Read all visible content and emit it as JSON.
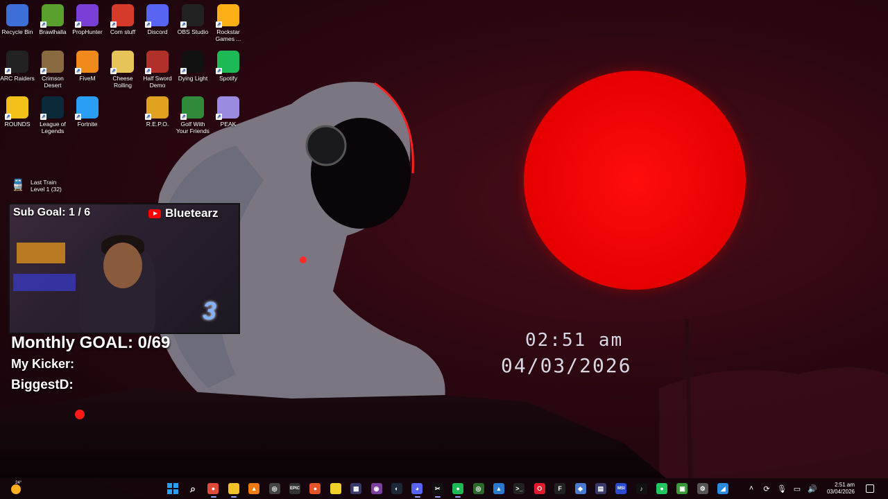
{
  "desktop_icons": [
    {
      "label": "Recycle Bin",
      "icon": "recycle-bin-icon",
      "color": "#3d6fd6"
    },
    {
      "label": "Brawlhalla",
      "icon": "brawlhalla-icon",
      "color": "#5aa02c"
    },
    {
      "label": "PropHunter",
      "icon": "prophunter-icon",
      "color": "#7a3fd6"
    },
    {
      "label": "Com stuff",
      "icon": "power-icon",
      "color": "#d63a2a"
    },
    {
      "label": "Discord",
      "icon": "discord-icon",
      "color": "#5865f2"
    },
    {
      "label": "OBS Studio",
      "icon": "obs-icon",
      "color": "#222222"
    },
    {
      "label": "Rockstar Games ...",
      "icon": "rockstar-icon",
      "color": "#fcaf17"
    },
    {
      "label": "ARC Raiders",
      "icon": "arc-raiders-icon",
      "color": "#222222"
    },
    {
      "label": "Crimson Desert",
      "icon": "crimson-desert-icon",
      "color": "#8a6a40"
    },
    {
      "label": "FiveM",
      "icon": "fivem-icon",
      "color": "#f08a1a"
    },
    {
      "label": "Cheese Rolling",
      "icon": "cheese-icon",
      "color": "#e6c45a"
    },
    {
      "label": "Half Sword Demo",
      "icon": "half-sword-icon",
      "color": "#b0302a"
    },
    {
      "label": "Dying Light",
      "icon": "dying-light-icon",
      "color": "#111111"
    },
    {
      "label": "Spotify",
      "icon": "spotify-icon",
      "color": "#1db954"
    },
    {
      "label": "ROUNDS",
      "icon": "rounds-icon",
      "color": "#f2c21b"
    },
    {
      "label": "League of Legends",
      "icon": "league-icon",
      "color": "#0a2a3a"
    },
    {
      "label": "Fortnite",
      "icon": "fortnite-icon",
      "color": "#2a9df4"
    },
    {
      "label": "R.E.P.O.",
      "icon": "repo-icon",
      "color": "#e0a020"
    },
    {
      "label": "Golf With Your Friends",
      "icon": "golf-icon",
      "color": "#2f8a3a"
    },
    {
      "label": "PEAK",
      "icon": "peak-icon",
      "color": "#9a8ae0"
    }
  ],
  "last_train": {
    "title": "Last Train",
    "subtitle": "Level 1  (32)"
  },
  "clock": {
    "time": "02:51 am",
    "date": "04/03/2026"
  },
  "overlay": {
    "sub_goal": "Sub Goal:  1 / 6",
    "channel": "Bluetearz",
    "monthly_goal": "Monthly GOAL: 0/69",
    "kicker": "My Kicker:",
    "biggest": "BiggestD:"
  },
  "weather": {
    "temp": "24°"
  },
  "taskbar_apps": [
    {
      "name": "start-icon",
      "label": "",
      "color": "#2aa0f0"
    },
    {
      "name": "search-icon",
      "label": "⌕",
      "color": "transparent"
    },
    {
      "name": "chrome-icon",
      "label": "●",
      "color": "#e04a3a"
    },
    {
      "name": "file-explorer-icon",
      "label": "",
      "color": "#f2c02a"
    },
    {
      "name": "vlc-icon",
      "label": "▲",
      "color": "#f07a10"
    },
    {
      "name": "steam-helper-icon",
      "label": "◎",
      "color": "#444444"
    },
    {
      "name": "epic-games-icon",
      "label": "EPIC",
      "color": "#333333"
    },
    {
      "name": "brave-icon",
      "label": "●",
      "color": "#e0552a"
    },
    {
      "name": "sticky-notes-icon",
      "label": "",
      "color": "#f2d02a"
    },
    {
      "name": "app-ms-icon",
      "label": "▦",
      "color": "#3a3a6a"
    },
    {
      "name": "tor-icon",
      "label": "◉",
      "color": "#7a3fa0"
    },
    {
      "name": "steam-icon",
      "label": "◐",
      "color": "#1b2838"
    },
    {
      "name": "discord-taskbar-icon",
      "label": "◕",
      "color": "#5865f2"
    },
    {
      "name": "capcut-icon",
      "label": "✂",
      "color": "#111111"
    },
    {
      "name": "spotify-taskbar-icon",
      "label": "●",
      "color": "#1db954"
    },
    {
      "name": "xbox-icon",
      "label": "◎",
      "color": "#2a6a2a"
    },
    {
      "name": "photos-icon",
      "label": "▲",
      "color": "#2a7ad0"
    },
    {
      "name": "terminal-icon",
      "label": ">_",
      "color": "#222222"
    },
    {
      "name": "opera-icon",
      "label": "O",
      "color": "#e01a2a"
    },
    {
      "name": "f-app-icon",
      "label": "F",
      "color": "#222222"
    },
    {
      "name": "proton-icon",
      "label": "◆",
      "color": "#4a7ad0"
    },
    {
      "name": "media-icon",
      "label": "▤",
      "color": "#3a3a6a"
    },
    {
      "name": "msi-icon",
      "label": "MSI",
      "color": "#2a4ad0"
    },
    {
      "name": "tiktok-icon",
      "label": "♪",
      "color": "#111111"
    },
    {
      "name": "line-icon",
      "label": "●",
      "color": "#22c55e"
    },
    {
      "name": "app-green-icon",
      "label": "▣",
      "color": "#3a9a3a"
    },
    {
      "name": "settings-icon",
      "label": "⚙",
      "color": "#555555"
    },
    {
      "name": "app-blue-icon",
      "label": "◢",
      "color": "#2a8ae0"
    }
  ],
  "tray": {
    "time": "2:51 am",
    "date": "03/04/2026"
  }
}
